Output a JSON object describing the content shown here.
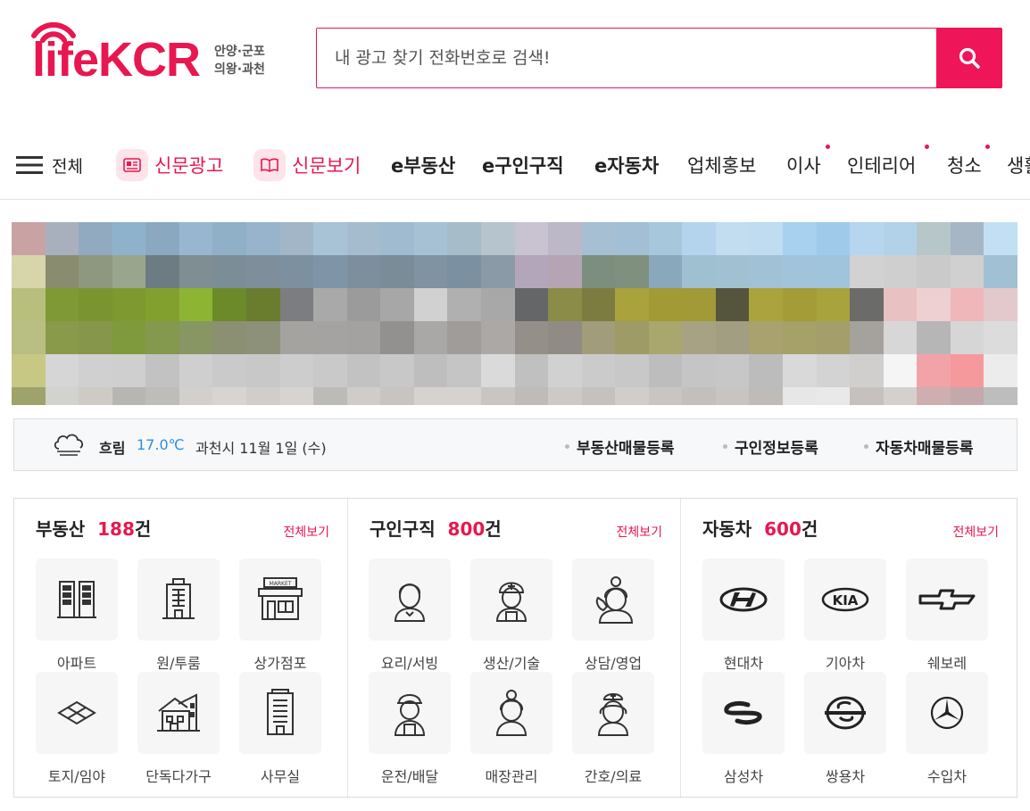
{
  "header": {
    "logo_text": "lifeKCR",
    "logo_regions_line1": "안양·군포",
    "logo_regions_line2": "의왕·과천",
    "search_placeholder": "내 광고 찾기 전화번호로 검색!"
  },
  "nav": {
    "all_label": "전체",
    "items": [
      {
        "label": "신문광고",
        "icon": "newspaper-icon",
        "style": "red"
      },
      {
        "label": "신문보기",
        "icon": "book-icon",
        "style": "red"
      },
      {
        "label": "e부동산"
      },
      {
        "label": "e구인구직"
      },
      {
        "label": "e자동차"
      },
      {
        "label": "업체홍보"
      },
      {
        "label": "이사",
        "dot": true
      },
      {
        "label": "인테리어",
        "dot": true
      },
      {
        "label": "청소",
        "dot": true
      },
      {
        "label": "생활"
      }
    ]
  },
  "weather": {
    "icon": "cloud-fog-icon",
    "condition": "흐림",
    "temperature": "17.0℃",
    "date": "과천시 11월 1일 (수)",
    "links": [
      "부동산매물등록",
      "구인정보등록",
      "자동차매물등록"
    ]
  },
  "categories": [
    {
      "title": "부동산",
      "count": "188",
      "unit": "건",
      "more": "전체보기",
      "items": [
        {
          "label": "아파트",
          "icon": "apartment-icon"
        },
        {
          "label": "원/투룸",
          "icon": "building-icon"
        },
        {
          "label": "상가점포",
          "icon": "market-icon"
        },
        {
          "label": "토지/임야",
          "icon": "land-icon"
        },
        {
          "label": "단독다가구",
          "icon": "house-icon"
        },
        {
          "label": "사무실",
          "icon": "office-icon"
        }
      ]
    },
    {
      "title": "구인구직",
      "count": "800",
      "unit": "건",
      "more": "전체보기",
      "items": [
        {
          "label": "요리/서빙",
          "icon": "waiter-icon"
        },
        {
          "label": "생산/기술",
          "icon": "worker-icon"
        },
        {
          "label": "상담/영업",
          "icon": "call-agent-icon"
        },
        {
          "label": "운전/배달",
          "icon": "driver-icon"
        },
        {
          "label": "매장관리",
          "icon": "store-staff-icon"
        },
        {
          "label": "간호/의료",
          "icon": "nurse-icon"
        }
      ]
    },
    {
      "title": "자동차",
      "count": "600",
      "unit": "건",
      "more": "전체보기",
      "items": [
        {
          "label": "현대차",
          "icon": "hyundai-logo-icon"
        },
        {
          "label": "기아차",
          "icon": "kia-logo-icon"
        },
        {
          "label": "쉐보레",
          "icon": "chevrolet-logo-icon"
        },
        {
          "label": "삼성차",
          "icon": "samsung-logo-icon"
        },
        {
          "label": "쌍용차",
          "icon": "ssangyong-logo-icon"
        },
        {
          "label": "수입차",
          "icon": "mercedes-logo-icon"
        }
      ]
    }
  ],
  "colors": {
    "accent": "#e8174f",
    "search_button": "#ee1559",
    "temperature": "#2b8fe0"
  }
}
